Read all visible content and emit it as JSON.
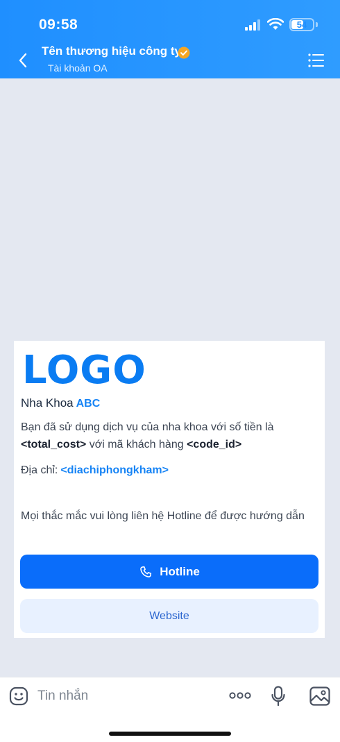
{
  "status": {
    "time": "09:58",
    "battery": "54"
  },
  "header": {
    "title": "Tên thương hiệu công ty",
    "subtitle": "Tài khoản OA"
  },
  "card": {
    "logo": "LOGO",
    "brand_name": "Nha Khoa",
    "brand_tag": "ABC",
    "message_pre": "Bạn đã sử dụng dịch vụ của nha khoa với số tiền là",
    "total_cost": "<total_cost>",
    "message_mid": "với mã khách hàng",
    "code_id": "<code_id>",
    "address_label": "Địa chỉ:",
    "address_value": "<diachiphongkham>",
    "note": "Mọi thắc mắc vui lòng liên hệ Hotline để được hướng dẫn",
    "hotline_label": "Hotline",
    "website_label": "Website"
  },
  "input": {
    "placeholder": "Tin nhắn"
  },
  "colors": {
    "header": "#1f8fff",
    "primary": "#0a6dfa",
    "link": "#1583f5",
    "background": "#e4e8f1"
  }
}
